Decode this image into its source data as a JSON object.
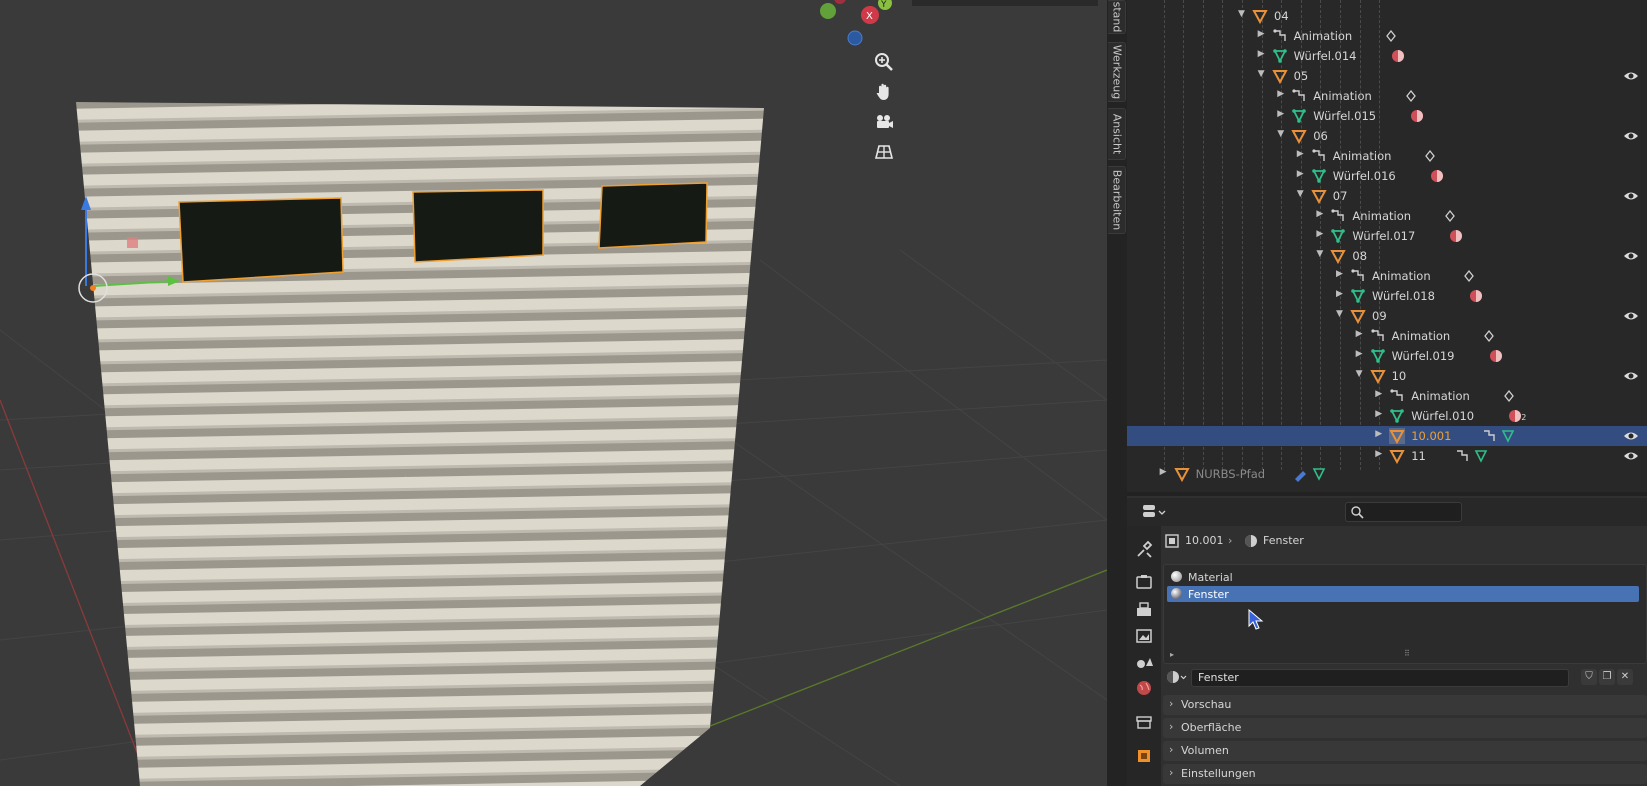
{
  "viewport": {
    "gizmo_axes": [
      "X",
      "Y"
    ],
    "nav_buttons": [
      "zoom-icon",
      "hand-pan-icon",
      "camera-icon",
      "grid-ortho-icon"
    ],
    "side_tabs": [
      "stand",
      "Werkzeug",
      "Ansicht",
      "Bearbeiten"
    ]
  },
  "outliner": {
    "rows": [
      {
        "label": "04",
        "type": "empty",
        "depth": 5,
        "expanded": true,
        "eye": false
      },
      {
        "label": "Animation",
        "type": "anim",
        "depth": 6
      },
      {
        "label": "Würfel.014",
        "type": "mesh",
        "depth": 6
      },
      {
        "label": "05",
        "type": "empty",
        "depth": 6,
        "expanded": true,
        "eye": true
      },
      {
        "label": "Animation",
        "type": "anim",
        "depth": 7
      },
      {
        "label": "Würfel.015",
        "type": "mesh",
        "depth": 7
      },
      {
        "label": "06",
        "type": "empty",
        "depth": 7,
        "expanded": true,
        "eye": true
      },
      {
        "label": "Animation",
        "type": "anim",
        "depth": 8
      },
      {
        "label": "Würfel.016",
        "type": "mesh",
        "depth": 8
      },
      {
        "label": "07",
        "type": "empty",
        "depth": 8,
        "expanded": true,
        "eye": true
      },
      {
        "label": "Animation",
        "type": "anim",
        "depth": 9
      },
      {
        "label": "Würfel.017",
        "type": "mesh",
        "depth": 9
      },
      {
        "label": "08",
        "type": "empty",
        "depth": 9,
        "expanded": true,
        "eye": true
      },
      {
        "label": "Animation",
        "type": "anim",
        "depth": 10
      },
      {
        "label": "Würfel.018",
        "type": "mesh",
        "depth": 10
      },
      {
        "label": "09",
        "type": "empty",
        "depth": 10,
        "expanded": true,
        "eye": true
      },
      {
        "label": "Animation",
        "type": "anim",
        "depth": 11
      },
      {
        "label": "Würfel.019",
        "type": "mesh",
        "depth": 11
      },
      {
        "label": "10",
        "type": "empty",
        "depth": 11,
        "expanded": true,
        "eye": true
      },
      {
        "label": "Animation",
        "type": "anim",
        "depth": 12
      },
      {
        "label": "Würfel.010",
        "type": "mesh",
        "depth": 12,
        "badge": "2"
      },
      {
        "label": "10.001",
        "type": "empty",
        "depth": 12,
        "selected": true,
        "eye": true
      },
      {
        "label": "11",
        "type": "empty",
        "depth": 12,
        "eye": true
      },
      {
        "label": "NURBS-Pfad",
        "type": "empty",
        "depth": 1,
        "dim": true
      }
    ]
  },
  "properties": {
    "breadcrumb_object": "10.001",
    "breadcrumb_material": "Fenster",
    "slots": [
      "Material",
      "Fenster"
    ],
    "active_slot": "Fenster",
    "material_name": "Fenster",
    "panels": [
      "Vorschau",
      "Oberfläche",
      "Volumen",
      "Einstellungen"
    ]
  },
  "colors": {
    "accent_selected": "#334d80",
    "active_slot": "#4772b3",
    "empty_icon": "#e8913a",
    "mesh_icon": "#2fbf8a",
    "material_icon": "#d0505a"
  }
}
